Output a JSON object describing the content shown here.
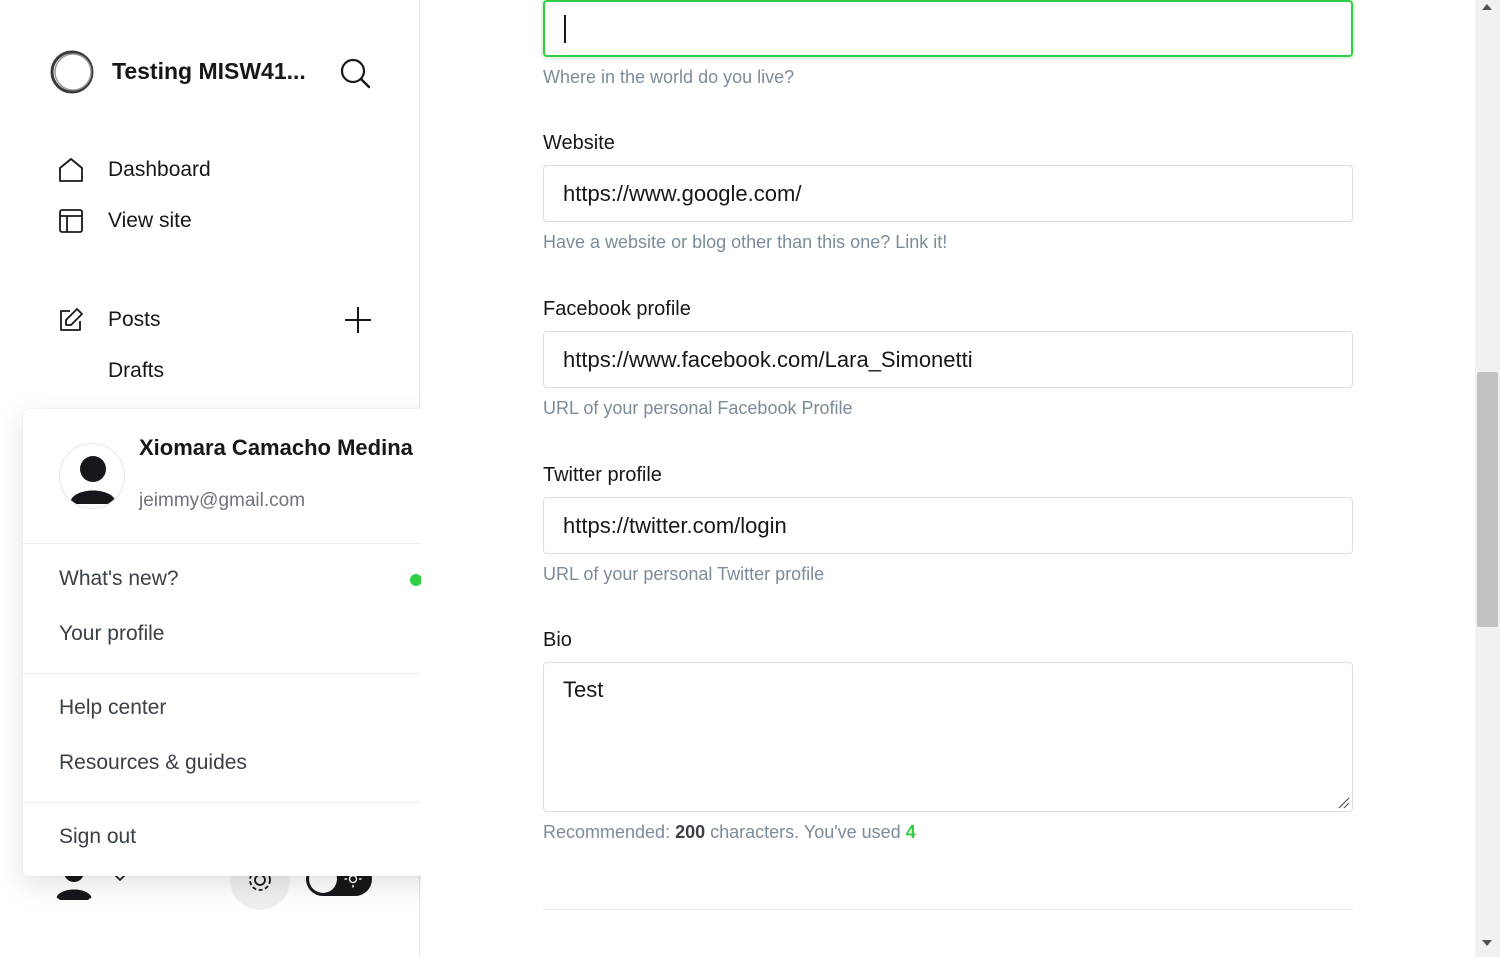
{
  "sidebar": {
    "site_title": "Testing MISW41...",
    "nav": {
      "dashboard": "Dashboard",
      "view_site": "View site",
      "posts": "Posts",
      "drafts": "Drafts"
    }
  },
  "user_menu": {
    "name": "Xiomara Camacho Medina",
    "email": "jeimmy@gmail.com",
    "items": {
      "whats_new": "What's new?",
      "your_profile": "Your profile",
      "help_center": "Help center",
      "resources": "Resources & guides",
      "sign_out": "Sign out"
    }
  },
  "form": {
    "location": {
      "value": "",
      "hint": "Where in the world do you live?"
    },
    "website": {
      "label": "Website",
      "value": "https://www.google.com/",
      "hint": "Have a website or blog other than this one? Link it!"
    },
    "facebook": {
      "label": "Facebook profile",
      "value": "https://www.facebook.com/Lara_Simonetti",
      "hint": "URL of your personal Facebook Profile"
    },
    "twitter": {
      "label": "Twitter profile",
      "value": "https://twitter.com/login",
      "hint": "URL of your personal Twitter profile"
    },
    "bio": {
      "label": "Bio",
      "value": "Test",
      "hint_prefix": "Recommended: ",
      "recommended": "200",
      "hint_middle": " characters. You've used ",
      "used": "4"
    }
  },
  "colors": {
    "accent_green": "#30cf43",
    "text_dark": "#15171a",
    "hint_gray": "#7c8b9a"
  }
}
